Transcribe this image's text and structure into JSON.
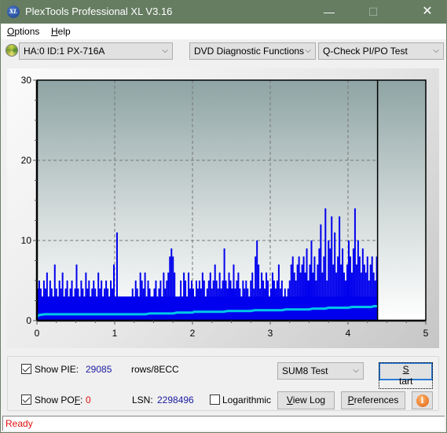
{
  "window": {
    "title": "PlexTools Professional XL V3.16",
    "app_icon_text": "XL",
    "controls": {
      "minimize": "—",
      "maximize": "☐",
      "close": "✕"
    }
  },
  "menu": [
    {
      "label": "Options",
      "accel": "O",
      "rest": "ptions"
    },
    {
      "label": "Help",
      "accel": "H",
      "rest": "elp"
    }
  ],
  "toolbar": {
    "drive": "HA:0 ID:1  PX-716A",
    "function": "DVD Diagnostic Functions",
    "test": "Q-Check PI/PO Test",
    "chevron": "⌵"
  },
  "colors": {
    "pie_bars": "#0000ee",
    "sum8_line": "#00c8e8",
    "status_text": "#e01010",
    "titlebar": "#667d62"
  },
  "chart_data": {
    "type": "bar",
    "title": "",
    "xlabel": "",
    "ylabel": "",
    "xlim": [
      0,
      5
    ],
    "ylim": [
      0,
      30
    ],
    "x_ticks": [
      "0",
      "1",
      "2",
      "3",
      "4",
      "5"
    ],
    "y_ticks": [
      "0",
      "10",
      "20",
      "30"
    ],
    "grid": true,
    "data_end_x": 4.38,
    "bin_width": 0.02,
    "series": [
      {
        "name": "PIE",
        "kind": "bar",
        "values": [
          4,
          5,
          4,
          3,
          5,
          4,
          6,
          3,
          5,
          4,
          3,
          7,
          4,
          3,
          5,
          4,
          6,
          3,
          4,
          5,
          3,
          4,
          5,
          3,
          4,
          7,
          4,
          3,
          5,
          4,
          3,
          6,
          4,
          5,
          3,
          4,
          5,
          4,
          3,
          6,
          4,
          5,
          3,
          4,
          5,
          4,
          3,
          5,
          4,
          7,
          3,
          11,
          3,
          3,
          3,
          3,
          3,
          3,
          3,
          3,
          3,
          4,
          3,
          5,
          4,
          3,
          6,
          5,
          4,
          6,
          3,
          5,
          4,
          3,
          3,
          4,
          5,
          3,
          4,
          5,
          3,
          6,
          4,
          5,
          6,
          8,
          9,
          8,
          6,
          3,
          2,
          3,
          5,
          3,
          6,
          5,
          3,
          6,
          4,
          5,
          4,
          3,
          5,
          4,
          5,
          4,
          6,
          5,
          3,
          4,
          5,
          6,
          4,
          5,
          7,
          5,
          4,
          6,
          4,
          5,
          9,
          5,
          4,
          6,
          5,
          4,
          7,
          4,
          5,
          6,
          4,
          3,
          5,
          4,
          5,
          4,
          3,
          5,
          6,
          4,
          8,
          10,
          7,
          4,
          6,
          5,
          4,
          6,
          5,
          3,
          4,
          6,
          5,
          4,
          5,
          7,
          4,
          5,
          3,
          4,
          3,
          4,
          5,
          7,
          8,
          6,
          5,
          7,
          8,
          6,
          7,
          8,
          6,
          9,
          5,
          7,
          10,
          6,
          8,
          5,
          7,
          9,
          12,
          6,
          8,
          14,
          5,
          10,
          9,
          13,
          7,
          11,
          6,
          8,
          13,
          7,
          9,
          6,
          5,
          7,
          10,
          8,
          6,
          9,
          14,
          7,
          10,
          8,
          6,
          9,
          7,
          6,
          8,
          5,
          7,
          8,
          6,
          5,
          8
        ],
        "baseline": 3
      },
      {
        "name": "SUM8",
        "kind": "line",
        "points": [
          [
            0,
            0.5
          ],
          [
            0.03,
            0.7
          ],
          [
            0.1,
            0.8
          ],
          [
            0.2,
            0.8
          ],
          [
            1.4,
            0.8
          ],
          [
            1.45,
            0.9
          ],
          [
            1.75,
            0.9
          ],
          [
            1.8,
            1.0
          ],
          [
            2.0,
            1.0
          ],
          [
            2.02,
            1.1
          ],
          [
            2.4,
            1.1
          ],
          [
            2.45,
            1.2
          ],
          [
            2.75,
            1.2
          ],
          [
            2.8,
            1.3
          ],
          [
            3.15,
            1.3
          ],
          [
            3.2,
            1.4
          ],
          [
            3.5,
            1.4
          ],
          [
            3.55,
            1.5
          ],
          [
            3.7,
            1.5
          ],
          [
            3.75,
            1.6
          ],
          [
            4.0,
            1.6
          ],
          [
            4.05,
            1.7
          ],
          [
            4.3,
            1.7
          ],
          [
            4.33,
            1.8
          ],
          [
            4.38,
            1.8
          ]
        ]
      }
    ]
  },
  "controls": {
    "show_pie": {
      "label": "Show PIE:",
      "checked": true,
      "value": "29085",
      "unit": "rows/8ECC"
    },
    "show_pof": {
      "label_pre": "Show PO",
      "accel": "F",
      "label_post": ":",
      "checked": true,
      "value": "0"
    },
    "lsn": {
      "label": "LSN:",
      "value": "2298496"
    },
    "logarithmic": {
      "label": "Logarithmic",
      "checked": false
    },
    "test_select": "SUM8 Test",
    "start": {
      "accel": "S",
      "rest": "tart"
    },
    "view_log": {
      "accel": "V",
      "rest": "iew Log"
    },
    "preferences": {
      "accel": "P",
      "rest": "references"
    },
    "info_icon": "i"
  },
  "status": {
    "text": "Ready"
  }
}
